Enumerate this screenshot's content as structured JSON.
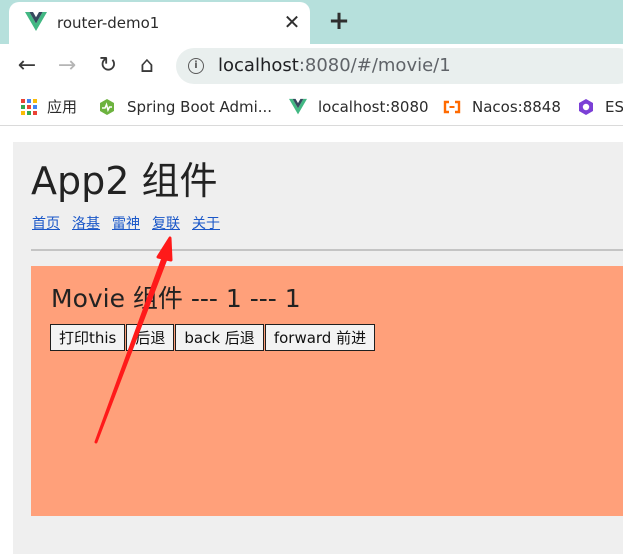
{
  "browser": {
    "tab": {
      "title": "router-demo1",
      "close_glyph": "✕"
    },
    "new_tab_glyph": "+",
    "toolbar": {
      "back_glyph": "←",
      "forward_glyph": "→",
      "reload_glyph": "↻",
      "home_glyph": "⌂",
      "info_glyph": "i",
      "url_host": "localhost",
      "url_rest": ":8080/#/movie/1"
    },
    "bookmarks": [
      {
        "label": "应用"
      },
      {
        "label": "Spring Boot Admi..."
      },
      {
        "label": "localhost:8080"
      },
      {
        "label": "Nacos:8848"
      },
      {
        "label": "ES"
      }
    ]
  },
  "page": {
    "title": "App2 组件",
    "nav_links": [
      "首页",
      "洛基",
      "雷神",
      "复联",
      "关于"
    ],
    "movie": {
      "title": "Movie 组件 --- 1 --- 1",
      "buttons": [
        "打印this",
        "后退",
        "back 后退",
        "forward 前进"
      ]
    }
  },
  "colors": {
    "tab_strip": "#b6e0dc",
    "movie_panel": "#ffa07a",
    "link": "#1a57c8",
    "arrow": "#ff1a1a",
    "vue_green": "#42b883",
    "vue_dark": "#35495e"
  }
}
